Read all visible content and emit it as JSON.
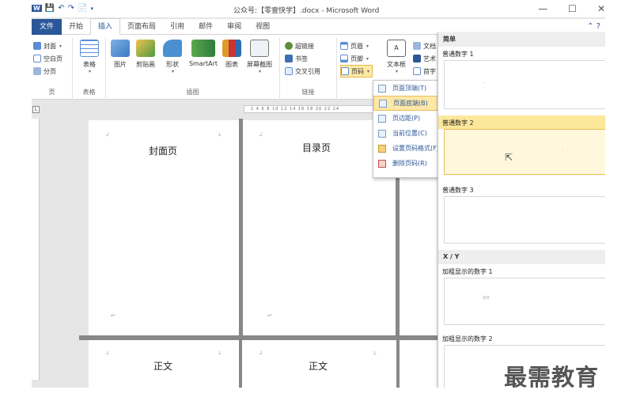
{
  "window": {
    "title": "公众号:【零壹快学】.docx - Microsoft Word",
    "minimize": "—",
    "maximize": "☐",
    "close": "✕"
  },
  "qat": [
    "W",
    "💾",
    "↶",
    "↷",
    "📄",
    "▾"
  ],
  "tabs": [
    "文件",
    "开始",
    "插入",
    "页面布局",
    "引用",
    "邮件",
    "审阅",
    "视图"
  ],
  "tabs_right": "⌃ ?",
  "ribbon": {
    "pages_group": {
      "items": [
        "封面",
        "空白页",
        "分页"
      ],
      "label": "页"
    },
    "table_group": {
      "button": "表格",
      "label": "表格"
    },
    "illus_group": {
      "buttons": [
        "图片",
        "剪贴画",
        "形状",
        "SmartArt",
        "图表",
        "屏幕截图"
      ],
      "label": "插图"
    },
    "links_group": {
      "items": [
        "超链接",
        "书签",
        "交叉引用"
      ],
      "label": "链接"
    },
    "header_group": {
      "items": [
        "页眉",
        "页脚",
        "页码"
      ],
      "textbox": "文本框",
      "side_items": [
        "文档",
        "艺术",
        "首字"
      ]
    }
  },
  "ruler": {
    "ticks": "2 4 6 8 10 12 14 16 18 20 22 24"
  },
  "pages": {
    "cover": "封面页",
    "toc": "目录页",
    "body1": "正文",
    "body2": "正文"
  },
  "menu": {
    "items": [
      {
        "label": "页面顶端(T)",
        "sub": true,
        "hl": false
      },
      {
        "label": "页面底端(B)",
        "sub": true,
        "hl": true
      },
      {
        "label": "页边距(P)",
        "sub": true,
        "hl": false
      },
      {
        "label": "当前位置(C)",
        "sub": true,
        "hl": false
      },
      {
        "label": "设置页码格式(F)...",
        "sub": false,
        "hl": false
      },
      {
        "label": "删除页码(R)",
        "sub": false,
        "hl": false
      }
    ]
  },
  "gallery": {
    "header": "简单",
    "items": [
      "普通数字 1",
      "普通数字 2",
      "普通数字 3"
    ],
    "section2": "X / Y",
    "items2": [
      "加粗显示的数字 1",
      "加粗显示的数字 2"
    ],
    "xy_sample": "X/X"
  },
  "watermark": "最需教育"
}
